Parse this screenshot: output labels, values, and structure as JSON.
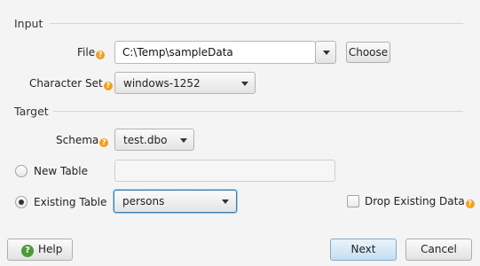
{
  "input_section": {
    "title": "Input",
    "file_label": "File",
    "file_value": "C:\\Temp\\sampleData",
    "choose_label": "Choose",
    "charset_label": "Character Set",
    "charset_value": "windows-1252"
  },
  "target_section": {
    "title": "Target",
    "schema_label": "Schema",
    "schema_value": "test.dbo",
    "new_table_label": "New Table",
    "new_table_value": "",
    "existing_table_label": "Existing Table",
    "existing_table_value": "persons",
    "drop_existing_label": "Drop Existing Data"
  },
  "footer": {
    "help_label": "Help",
    "next_label": "Next",
    "cancel_label": "Cancel"
  },
  "icons": {
    "help_badge": "question-mark-icon",
    "help_button": "help-icon",
    "dropdown": "chevron-down-icon"
  },
  "colors": {
    "help_badge": "#f0a020",
    "help_button_icon": "#4a9a3a",
    "default_button": "#c5def1"
  }
}
